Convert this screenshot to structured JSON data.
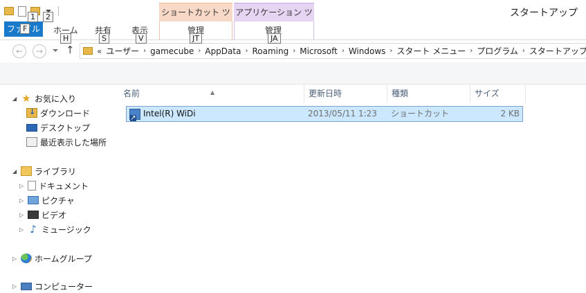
{
  "window": {
    "title": "スタートアップ"
  },
  "quick_access": {
    "keytip_1": "1",
    "keytip_2": "2"
  },
  "context_tabs": {
    "shortcut_tools": "ショートカット ツール",
    "app_tools": "アプリケーション ツール"
  },
  "ribbon": {
    "file": {
      "label": "ファイル",
      "keytip": "F"
    },
    "tabs": [
      {
        "label": "ホーム",
        "keytip": "H"
      },
      {
        "label": "共有",
        "keytip": "S"
      },
      {
        "label": "表示",
        "keytip": "V"
      },
      {
        "label": "管理",
        "keytip": "JT"
      },
      {
        "label": "管理",
        "keytip": "JA"
      }
    ]
  },
  "address": {
    "overflow": "«",
    "crumbs": [
      "ユーザー",
      "gamecube",
      "AppData",
      "Roaming",
      "Microsoft",
      "Windows",
      "スタート メニュー",
      "プログラム",
      "スタートアップ"
    ]
  },
  "nav": {
    "favorites": {
      "label": "お気に入り",
      "items": [
        "ダウンロード",
        "デスクトップ",
        "最近表示した場所"
      ]
    },
    "libraries": {
      "label": "ライブラリ",
      "items": [
        "ドキュメント",
        "ピクチャ",
        "ビデオ",
        "ミュージック"
      ]
    },
    "homegroup": "ホームグループ",
    "computer": "コンピューター"
  },
  "columns": {
    "name": "名前",
    "modified": "更新日時",
    "type": "種類",
    "size": "サイズ"
  },
  "files": [
    {
      "name": "Intel(R) WiDi",
      "modified": "2013/05/11 1:23",
      "type": "ショートカット",
      "size": "2 KB"
    }
  ],
  "colors": {
    "file_tab": "#1979ca",
    "selection_fill": "#cce8ff",
    "selection_border": "#7da2ce",
    "shortcut_tab": "#f8d8c6",
    "app_tab": "#e5d5f2"
  }
}
